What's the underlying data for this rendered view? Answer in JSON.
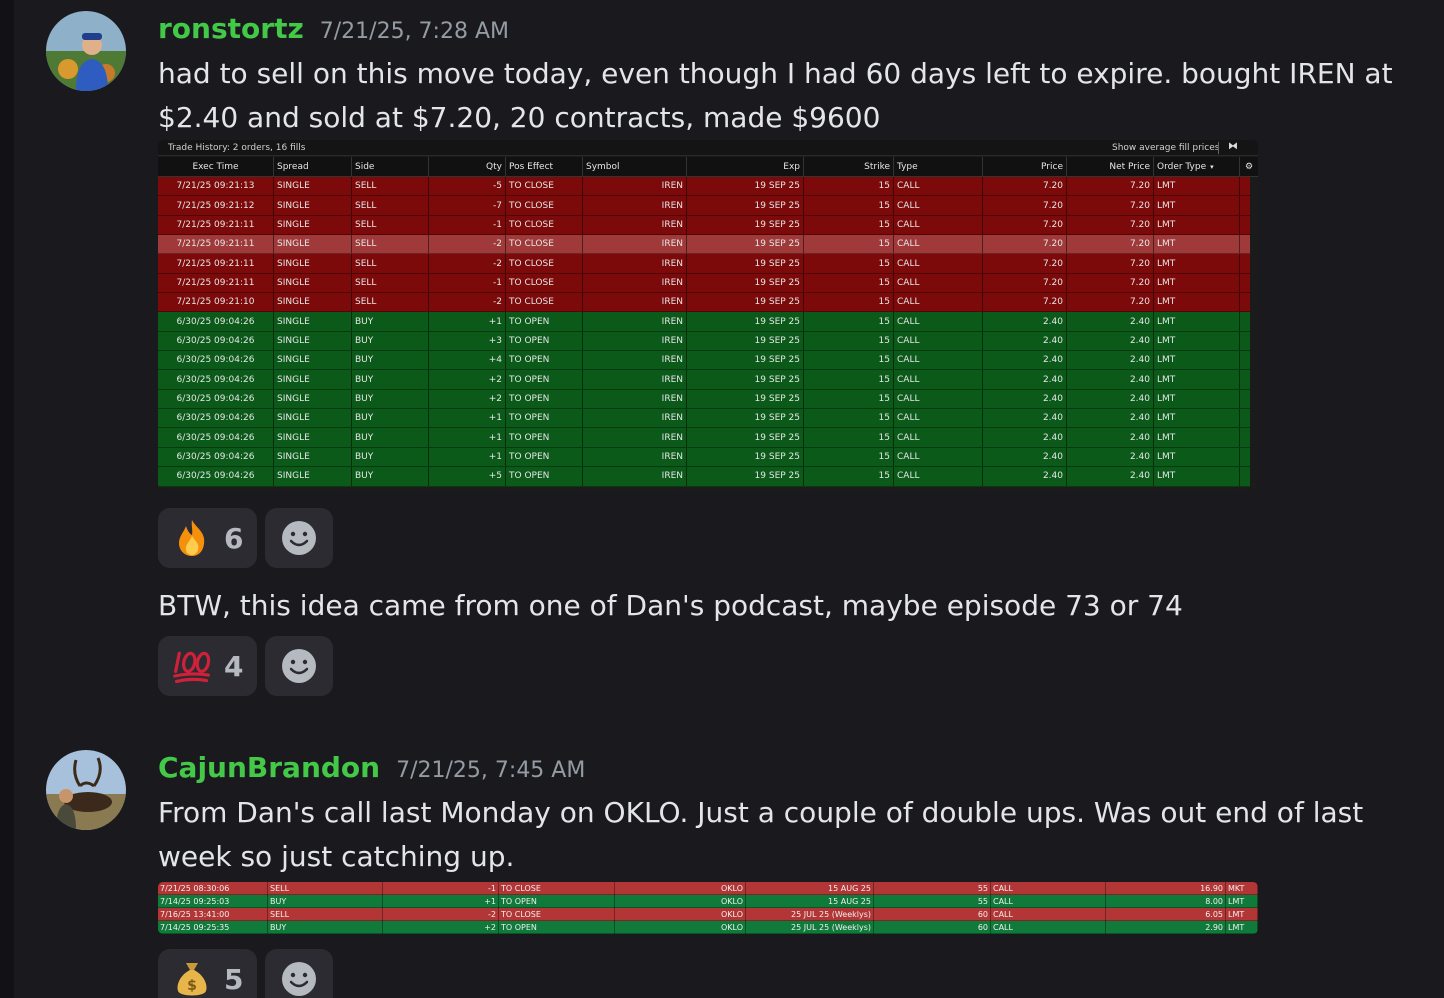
{
  "messages": [
    {
      "username": "ronstortz",
      "timestamp": "7/21/25, 7:28 AM",
      "text": "had to sell on this move today, even though I had 60 days left to expire. bought IREN at $2.40 and sold at $7.20,  20 contracts, made $9600",
      "reaction": {
        "emoji": "fire",
        "count": "6"
      },
      "followup_text": "BTW, this idea came from one of Dan's podcast, maybe episode 73 or 74",
      "followup_reaction": {
        "emoji": "hundred-points",
        "count": "4"
      }
    },
    {
      "username": "CajunBrandon",
      "timestamp": "7/21/25, 7:45 AM",
      "text": "From Dan's call last Monday on OKLO.  Just a couple of double ups.  Was out end of last week so just catching up.",
      "reaction": {
        "emoji": "money-bag",
        "count": "5"
      }
    }
  ],
  "trade_history": {
    "title": "Trade History: 2 orders, 16 fills",
    "toggle_label": "Show average fill prices",
    "headers": {
      "exec_time": "Exec Time",
      "spread": "Spread",
      "side": "Side",
      "qty": "Qty",
      "pos_effect": "Pos Effect",
      "symbol": "Symbol",
      "exp": "Exp",
      "strike": "Strike",
      "type": "Type",
      "price": "Price",
      "net_price": "Net Price",
      "order_type": "Order Type"
    },
    "rows": [
      {
        "time": "7/21/25 09:21:13",
        "spread": "SINGLE",
        "side": "SELL",
        "qty": "-5",
        "pos": "TO CLOSE",
        "sym": "IREN",
        "exp": "19 SEP 25",
        "strike": "15",
        "type": "CALL",
        "price": "7.20",
        "net": "7.20",
        "otype": "LMT"
      },
      {
        "time": "7/21/25 09:21:12",
        "spread": "SINGLE",
        "side": "SELL",
        "qty": "-7",
        "pos": "TO CLOSE",
        "sym": "IREN",
        "exp": "19 SEP 25",
        "strike": "15",
        "type": "CALL",
        "price": "7.20",
        "net": "7.20",
        "otype": "LMT"
      },
      {
        "time": "7/21/25 09:21:11",
        "spread": "SINGLE",
        "side": "SELL",
        "qty": "-1",
        "pos": "TO CLOSE",
        "sym": "IREN",
        "exp": "19 SEP 25",
        "strike": "15",
        "type": "CALL",
        "price": "7.20",
        "net": "7.20",
        "otype": "LMT"
      },
      {
        "time": "7/21/25 09:21:11",
        "spread": "SINGLE",
        "side": "SELL",
        "qty": "-2",
        "pos": "TO CLOSE",
        "sym": "IREN",
        "exp": "19 SEP 25",
        "strike": "15",
        "type": "CALL",
        "price": "7.20",
        "net": "7.20",
        "otype": "LMT"
      },
      {
        "time": "7/21/25 09:21:11",
        "spread": "SINGLE",
        "side": "SELL",
        "qty": "-2",
        "pos": "TO CLOSE",
        "sym": "IREN",
        "exp": "19 SEP 25",
        "strike": "15",
        "type": "CALL",
        "price": "7.20",
        "net": "7.20",
        "otype": "LMT"
      },
      {
        "time": "7/21/25 09:21:11",
        "spread": "SINGLE",
        "side": "SELL",
        "qty": "-1",
        "pos": "TO CLOSE",
        "sym": "IREN",
        "exp": "19 SEP 25",
        "strike": "15",
        "type": "CALL",
        "price": "7.20",
        "net": "7.20",
        "otype": "LMT"
      },
      {
        "time": "7/21/25 09:21:10",
        "spread": "SINGLE",
        "side": "SELL",
        "qty": "-2",
        "pos": "TO CLOSE",
        "sym": "IREN",
        "exp": "19 SEP 25",
        "strike": "15",
        "type": "CALL",
        "price": "7.20",
        "net": "7.20",
        "otype": "LMT"
      },
      {
        "time": "6/30/25 09:04:26",
        "spread": "SINGLE",
        "side": "BUY",
        "qty": "+1",
        "pos": "TO OPEN",
        "sym": "IREN",
        "exp": "19 SEP 25",
        "strike": "15",
        "type": "CALL",
        "price": "2.40",
        "net": "2.40",
        "otype": "LMT"
      },
      {
        "time": "6/30/25 09:04:26",
        "spread": "SINGLE",
        "side": "BUY",
        "qty": "+3",
        "pos": "TO OPEN",
        "sym": "IREN",
        "exp": "19 SEP 25",
        "strike": "15",
        "type": "CALL",
        "price": "2.40",
        "net": "2.40",
        "otype": "LMT"
      },
      {
        "time": "6/30/25 09:04:26",
        "spread": "SINGLE",
        "side": "BUY",
        "qty": "+4",
        "pos": "TO OPEN",
        "sym": "IREN",
        "exp": "19 SEP 25",
        "strike": "15",
        "type": "CALL",
        "price": "2.40",
        "net": "2.40",
        "otype": "LMT"
      },
      {
        "time": "6/30/25 09:04:26",
        "spread": "SINGLE",
        "side": "BUY",
        "qty": "+2",
        "pos": "TO OPEN",
        "sym": "IREN",
        "exp": "19 SEP 25",
        "strike": "15",
        "type": "CALL",
        "price": "2.40",
        "net": "2.40",
        "otype": "LMT"
      },
      {
        "time": "6/30/25 09:04:26",
        "spread": "SINGLE",
        "side": "BUY",
        "qty": "+2",
        "pos": "TO OPEN",
        "sym": "IREN",
        "exp": "19 SEP 25",
        "strike": "15",
        "type": "CALL",
        "price": "2.40",
        "net": "2.40",
        "otype": "LMT"
      },
      {
        "time": "6/30/25 09:04:26",
        "spread": "SINGLE",
        "side": "BUY",
        "qty": "+1",
        "pos": "TO OPEN",
        "sym": "IREN",
        "exp": "19 SEP 25",
        "strike": "15",
        "type": "CALL",
        "price": "2.40",
        "net": "2.40",
        "otype": "LMT"
      },
      {
        "time": "6/30/25 09:04:26",
        "spread": "SINGLE",
        "side": "BUY",
        "qty": "+1",
        "pos": "TO OPEN",
        "sym": "IREN",
        "exp": "19 SEP 25",
        "strike": "15",
        "type": "CALL",
        "price": "2.40",
        "net": "2.40",
        "otype": "LMT"
      },
      {
        "time": "6/30/25 09:04:26",
        "spread": "SINGLE",
        "side": "BUY",
        "qty": "+1",
        "pos": "TO OPEN",
        "sym": "IREN",
        "exp": "19 SEP 25",
        "strike": "15",
        "type": "CALL",
        "price": "2.40",
        "net": "2.40",
        "otype": "LMT"
      },
      {
        "time": "6/30/25 09:04:26",
        "spread": "SINGLE",
        "side": "BUY",
        "qty": "+5",
        "pos": "TO OPEN",
        "sym": "IREN",
        "exp": "19 SEP 25",
        "strike": "15",
        "type": "CALL",
        "price": "2.40",
        "net": "2.40",
        "otype": "LMT"
      }
    ]
  },
  "oklo_trades": [
    {
      "time": "7/21/25 08:30:06",
      "side": "SELL",
      "qty": "-1",
      "pos": "TO CLOSE",
      "sym": "OKLO",
      "exp": "15 AUG 25",
      "strike": "55",
      "type": "CALL",
      "price": "16.90",
      "otype": "MKT"
    },
    {
      "time": "7/14/25 09:25:03",
      "side": "BUY",
      "qty": "+1",
      "pos": "TO OPEN",
      "sym": "OKLO",
      "exp": "15 AUG 25",
      "strike": "55",
      "type": "CALL",
      "price": "8.00",
      "otype": "LMT"
    },
    {
      "time": "7/16/25 13:41:00",
      "side": "SELL",
      "qty": "-2",
      "pos": "TO CLOSE",
      "sym": "OKLO",
      "exp": "25 JUL 25 (Weeklys)",
      "strike": "60",
      "type": "CALL",
      "price": "6.05",
      "otype": "LMT"
    },
    {
      "time": "7/14/25 09:25:35",
      "side": "BUY",
      "qty": "+2",
      "pos": "TO OPEN",
      "sym": "OKLO",
      "exp": "25 JUL 25 (Weeklys)",
      "strike": "60",
      "type": "CALL",
      "price": "2.90",
      "otype": "LMT"
    }
  ],
  "colors": {
    "username": "#43c848",
    "sell_row": "#7c0a0a",
    "buy_row": "#0b5a1a",
    "background": "#1a1a1e"
  }
}
